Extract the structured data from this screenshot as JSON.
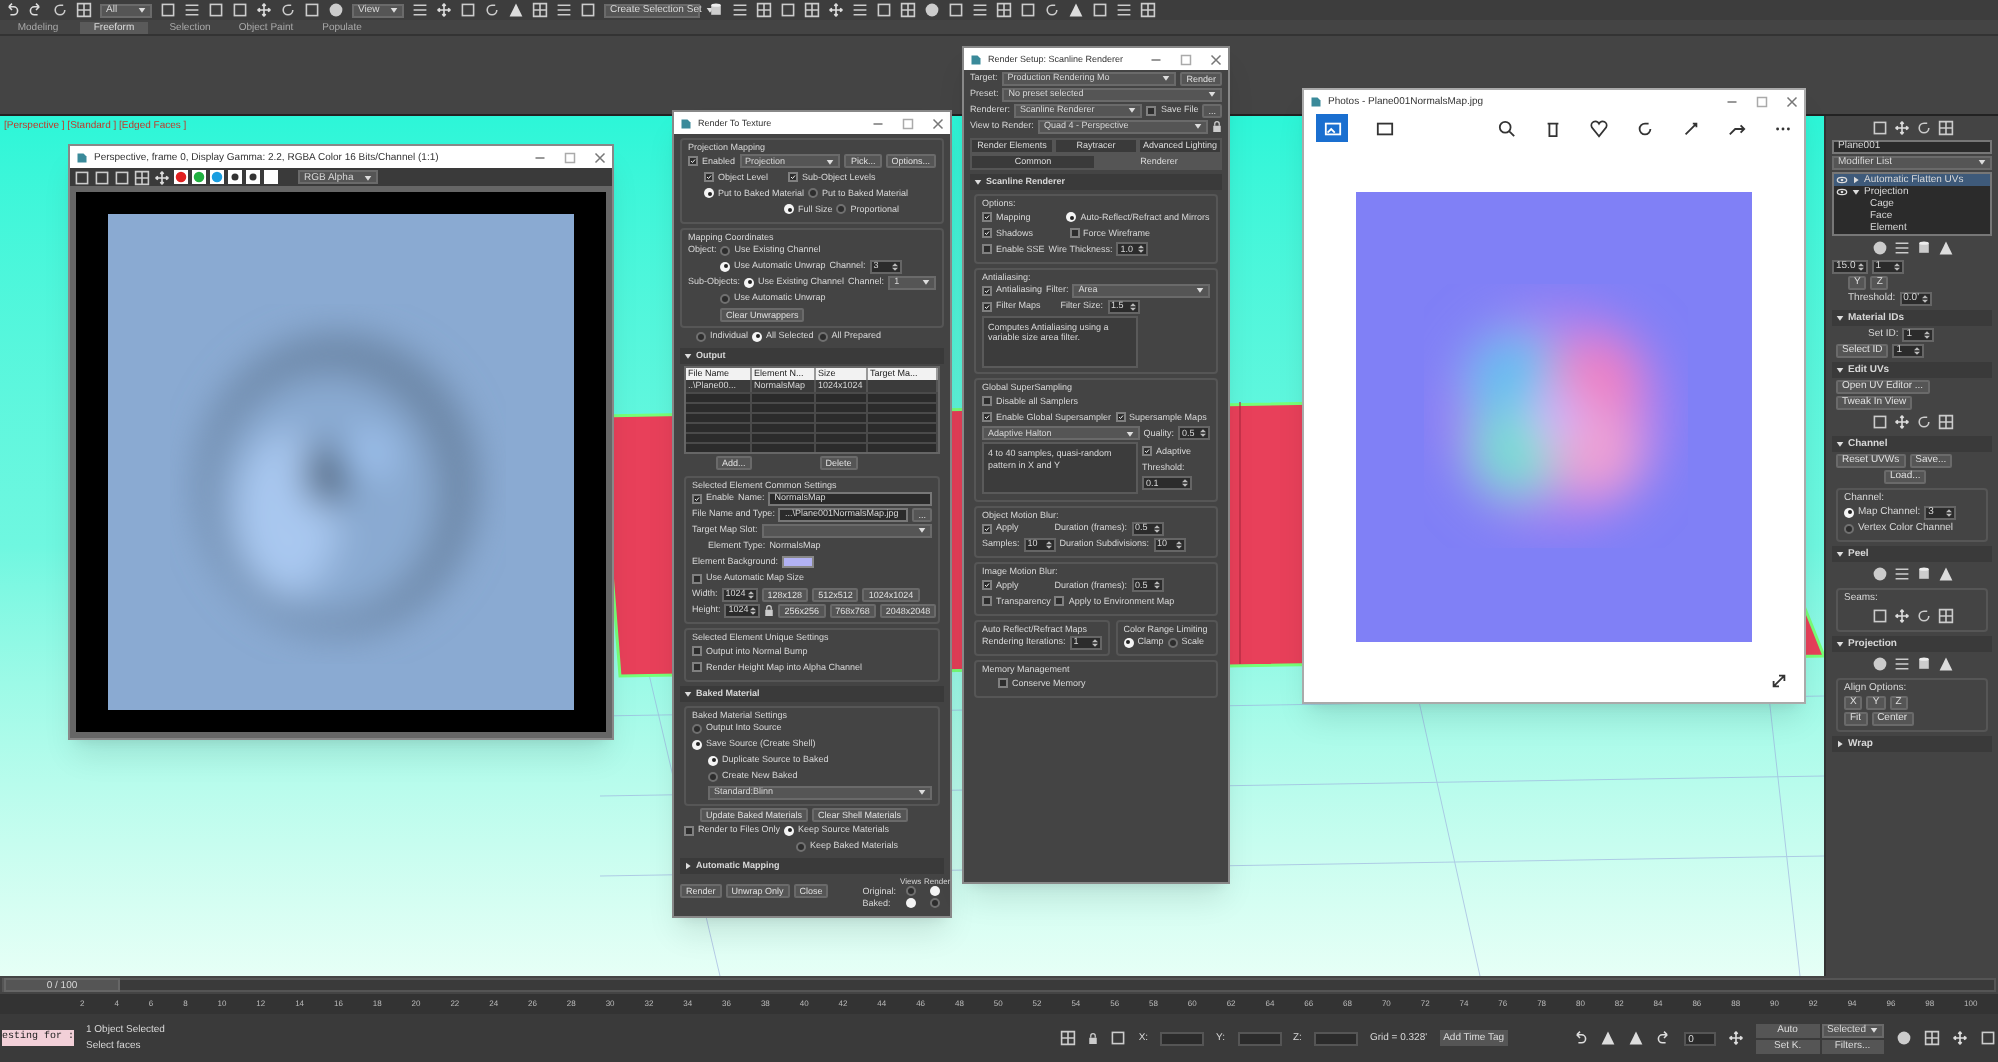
{
  "toolbar": {
    "dropdowns": [
      "All",
      "View",
      "Create Selection Set"
    ]
  },
  "ribbon_tabs": [
    {
      "label": "Modeling",
      "selected": false
    },
    {
      "label": "Freeform",
      "selected": true
    },
    {
      "label": "Selection",
      "selected": false
    },
    {
      "label": "Object Paint",
      "selected": false
    },
    {
      "label": "Populate",
      "selected": false
    }
  ],
  "viewport": {
    "label": "[Perspective ] [Standard ] [Edged Faces ]"
  },
  "frame_buffer": {
    "title": "Perspective, frame 0, Display Gamma: 2.2, RGBA Color 16 Bits/Channel (1:1)",
    "channel": "RGB Alpha"
  },
  "render_to_texture": {
    "title": "Render To Texture",
    "blocks": [
      {
        "kind": "group",
        "title": "Projection Mapping",
        "blocks": [
          {
            "kind": "row",
            "items": [
              {
                "kind": "check",
                "label": "Enabled",
                "checked": true
              },
              {
                "kind": "dropdown",
                "value": "Projection"
              },
              {
                "kind": "button",
                "label": "Pick..."
              },
              {
                "kind": "button",
                "label": "Options..."
              }
            ]
          },
          {
            "kind": "row",
            "items": [
              {
                "kind": "indent"
              },
              {
                "kind": "check",
                "label": "Object Level",
                "checked": true
              },
              {
                "kind": "indent"
              },
              {
                "kind": "check",
                "label": "Sub-Object Levels",
                "checked": true
              }
            ]
          },
          {
            "kind": "row",
            "items": [
              {
                "kind": "indent"
              },
              {
                "kind": "radio",
                "label": "Put to Baked Material",
                "selected": true
              },
              {
                "kind": "radio",
                "label": "Put to Baked Material",
                "selected": false
              }
            ]
          },
          {
            "kind": "row",
            "items": [
              {
                "kind": "indent"
              },
              {
                "kind": "indent"
              },
              {
                "kind": "indent"
              },
              {
                "kind": "indent"
              },
              {
                "kind": "indent"
              },
              {
                "kind": "indent"
              },
              {
                "kind": "radio",
                "label": "Full Size",
                "selected": true
              },
              {
                "kind": "radio",
                "label": "Proportional",
                "selected": false
              }
            ]
          }
        ]
      },
      {
        "kind": "group",
        "title": "Mapping Coordinates",
        "blocks": [
          {
            "kind": "row",
            "items": [
              {
                "kind": "label",
                "text": "Object:"
              },
              {
                "kind": "radio",
                "label": "Use Existing Channel",
                "selected": false
              }
            ]
          },
          {
            "kind": "row",
            "items": [
              {
                "kind": "indent"
              },
              {
                "kind": "indent"
              },
              {
                "kind": "radio",
                "label": "Use Automatic Unwrap",
                "selected": true
              },
              {
                "kind": "label",
                "text": "Channel:"
              },
              {
                "kind": "spinner",
                "value": "3"
              }
            ]
          },
          {
            "kind": "row",
            "items": [
              {
                "kind": "label",
                "text": "Sub-Objects:"
              },
              {
                "kind": "radio",
                "label": "Use Existing Channel",
                "selected": true
              },
              {
                "kind": "label",
                "text": "Channel:"
              },
              {
                "kind": "dropdown",
                "value": "1"
              }
            ]
          },
          {
            "kind": "row",
            "items": [
              {
                "kind": "indent"
              },
              {
                "kind": "indent"
              },
              {
                "kind": "radio",
                "label": "Use Automatic Unwrap",
                "selected": false
              }
            ]
          },
          {
            "kind": "row",
            "items": [
              {
                "kind": "indent"
              },
              {
                "kind": "indent"
              },
              {
                "kind": "button",
                "label": "Clear Unwrappers"
              }
            ]
          }
        ]
      },
      {
        "kind": "row",
        "items": [
          {
            "kind": "indent"
          },
          {
            "kind": "radio",
            "label": "Individual",
            "selected": false
          },
          {
            "kind": "radio",
            "label": "All Selected",
            "selected": true
          },
          {
            "kind": "radio",
            "label": "All Prepared",
            "selected": false
          }
        ]
      },
      {
        "kind": "rollout",
        "title": "Output",
        "expanded": true,
        "blocks": [
          {
            "kind": "table",
            "columns": [
              "File Name",
              "Element N...",
              "Size",
              "Target Ma..."
            ],
            "rows": [
              [
                "..\\Plane00...",
                "NormalsMap",
                "1024x1024",
                ""
              ]
            ]
          },
          {
            "kind": "row",
            "items": [
              {
                "kind": "indent"
              },
              {
                "kind": "indent"
              },
              {
                "kind": "button",
                "label": "Add..."
              },
              {
                "kind": "indent"
              },
              {
                "kind": "indent"
              },
              {
                "kind": "indent"
              },
              {
                "kind": "indent"
              },
              {
                "kind": "button",
                "label": "Delete"
              }
            ]
          },
          {
            "kind": "group",
            "title": "Selected Element Common Settings",
            "blocks": [
              {
                "kind": "row",
                "items": [
                  {
                    "kind": "check",
                    "label": "Enable",
                    "checked": true
                  },
                  {
                    "kind": "label",
                    "text": "Name:"
                  },
                  {
                    "kind": "field",
                    "value": "NormalsMap"
                  }
                ]
              },
              {
                "kind": "row",
                "items": [
                  {
                    "kind": "label",
                    "text": "File Name and Type:"
                  },
                  {
                    "kind": "field",
                    "value": "...\\Plane001NormalsMap.jpg"
                  },
                  {
                    "kind": "button",
                    "label": "..."
                  }
                ]
              },
              {
                "kind": "row",
                "items": [
                  {
                    "kind": "label",
                    "text": "Target Map Slot:"
                  },
                  {
                    "kind": "dropdown",
                    "value": ""
                  }
                ]
              },
              {
                "kind": "row",
                "items": [
                  {
                    "kind": "indent"
                  },
                  {
                    "kind": "label",
                    "text": "Element Type:"
                  },
                  {
                    "kind": "label",
                    "text": "NormalsMap"
                  }
                ]
              },
              {
                "kind": "row",
                "items": [
                  {
                    "kind": "label",
                    "text": "Element Background:"
                  },
                  {
                    "kind": "swatch"
                  }
                ]
              },
              {
                "kind": "row",
                "items": [
                  {
                    "kind": "check",
                    "label": "Use Automatic Map Size",
                    "checked": false
                  }
                ]
              },
              {
                "kind": "row",
                "items": [
                  {
                    "kind": "label",
                    "text": "Width:"
                  },
                  {
                    "kind": "spinner",
                    "value": "1024"
                  },
                  {
                    "kind": "button",
                    "label": "128x128"
                  },
                  {
                    "kind": "button",
                    "label": "512x512"
                  },
                  {
                    "kind": "button",
                    "label": "1024x1024"
                  }
                ]
              },
              {
                "kind": "row",
                "items": [
                  {
                    "kind": "label",
                    "text": "Height:"
                  },
                  {
                    "kind": "spinner",
                    "value": "1024"
                  },
                  {
                    "kind": "lock"
                  },
                  {
                    "kind": "button",
                    "label": "256x256"
                  },
                  {
                    "kind": "button",
                    "label": "768x768"
                  },
                  {
                    "kind": "button",
                    "label": "2048x2048"
                  }
                ]
              }
            ]
          },
          {
            "kind": "group",
            "title": "Selected Element Unique Settings",
            "blocks": [
              {
                "kind": "row",
                "items": [
                  {
                    "kind": "check",
                    "label": "Output into Normal Bump",
                    "checked": false
                  }
                ]
              },
              {
                "kind": "row",
                "items": [
                  {
                    "kind": "check",
                    "label": "Render Height Map into Alpha Channel",
                    "checked": false
                  }
                ]
              }
            ]
          }
        ]
      },
      {
        "kind": "rollout",
        "title": "Baked Material",
        "expanded": true,
        "blocks": [
          {
            "kind": "group",
            "title": "Baked Material Settings",
            "blocks": [
              {
                "kind": "row",
                "items": [
                  {
                    "kind": "radio",
                    "label": "Output Into Source",
                    "selected": false
                  }
                ]
              },
              {
                "kind": "row",
                "items": [
                  {
                    "kind": "radio",
                    "label": "Save Source (Create Shell)",
                    "selected": true
                  }
                ]
              },
              {
                "kind": "row",
                "items": [
                  {
                    "kind": "indent"
                  },
                  {
                    "kind": "radio",
                    "label": "Duplicate Source to Baked",
                    "selected": true
                  }
                ]
              },
              {
                "kind": "row",
                "items": [
                  {
                    "kind": "indent"
                  },
                  {
                    "kind": "radio",
                    "label": "Create New Baked",
                    "selected": false
                  }
                ]
              },
              {
                "kind": "row",
                "items": [
                  {
                    "kind": "indent"
                  },
                  {
                    "kind": "dropdown",
                    "value": "Standard:Blinn"
                  }
                ]
              }
            ]
          },
          {
            "kind": "row",
            "items": [
              {
                "kind": "indent"
              },
              {
                "kind": "button",
                "label": "Update Baked Materials"
              },
              {
                "kind": "button",
                "label": "Clear Shell Materials"
              }
            ]
          },
          {
            "kind": "row",
            "items": [
              {
                "kind": "check",
                "label": "Render to Files Only",
                "checked": false
              },
              {
                "kind": "radio",
                "label": "Keep Source Materials",
                "selected": true
              }
            ]
          },
          {
            "kind": "row",
            "items": [
              {
                "kind": "indent"
              },
              {
                "kind": "indent"
              },
              {
                "kind": "indent"
              },
              {
                "kind": "indent"
              },
              {
                "kind": "indent"
              },
              {
                "kind": "indent"
              },
              {
                "kind": "indent"
              },
              {
                "kind": "radio",
                "label": "Keep Baked Materials",
                "selected": false
              }
            ]
          }
        ]
      },
      {
        "kind": "rollout",
        "title": "Automatic Mapping",
        "expanded": false
      },
      {
        "kind": "row",
        "items": [
          {
            "kind": "button",
            "label": "Render"
          },
          {
            "kind": "button",
            "label": "Unwrap Only"
          },
          {
            "kind": "button",
            "label": "Close"
          },
          {
            "kind": "matrix",
            "columns": [
              "Views",
              "Render"
            ],
            "rows": [
              {
                "label": "Original:",
                "options": [
                  {
                    "selected": false
                  },
                  {
                    "selected": true
                  }
                ]
              },
              {
                "label": "Baked:",
                "options": [
                  {
                    "selected": true
                  },
                  {
                    "selected": false
                  }
                ]
              }
            ]
          }
        ]
      }
    ]
  },
  "render_setup": {
    "title": "Render Setup: Scanline Renderer",
    "blocks": [
      {
        "kind": "row",
        "items": [
          {
            "kind": "label",
            "text": "Target:"
          },
          {
            "kind": "dropdown",
            "value": "Production Rendering Mo"
          },
          {
            "kind": "button",
            "label": "Render"
          }
        ]
      },
      {
        "kind": "row",
        "items": [
          {
            "kind": "label",
            "text": "Preset:"
          },
          {
            "kind": "dropdown",
            "value": "No preset selected"
          }
        ]
      },
      {
        "kind": "row",
        "items": [
          {
            "kind": "label",
            "text": "Renderer:"
          },
          {
            "kind": "dropdown",
            "value": "Scanline Renderer"
          },
          {
            "kind": "check",
            "label": "Save File",
            "checked": false
          },
          {
            "kind": "button",
            "label": "..."
          }
        ]
      },
      {
        "kind": "row",
        "items": [
          {
            "kind": "label",
            "text": "View to Render:"
          },
          {
            "kind": "dropdown",
            "value": "Quad 4 - Perspective"
          },
          {
            "kind": "lock"
          }
        ]
      },
      {
        "kind": "tabs",
        "tabs": [
          {
            "label": "Render Elements",
            "selected": false
          },
          {
            "label": "Raytracer",
            "selected": false
          },
          {
            "label": "Advanced Lighting",
            "selected": false
          },
          {
            "label": "Common",
            "selected": false
          },
          {
            "label": "Renderer",
            "selected": true
          }
        ]
      },
      {
        "kind": "rollout",
        "title": "Scanline Renderer",
        "expanded": true,
        "blocks": [
          {
            "kind": "group",
            "title": "Options:",
            "blocks": [
              {
                "kind": "row",
                "items": [
                  {
                    "kind": "check",
                    "label": "Mapping",
                    "checked": true
                  },
                  {
                    "kind": "indent"
                  },
                  {
                    "kind": "indent"
                  },
                  {
                    "kind": "radio",
                    "label": "Auto-Reflect/Refract and Mirrors",
                    "selected": true
                  }
                ]
              },
              {
                "kind": "row",
                "items": [
                  {
                    "kind": "check",
                    "label": "Shadows",
                    "checked": true
                  },
                  {
                    "kind": "indent"
                  },
                  {
                    "kind": "indent"
                  },
                  {
                    "kind": "check",
                    "label": "Force Wireframe",
                    "checked": false
                  }
                ]
              },
              {
                "kind": "row",
                "items": [
                  {
                    "kind": "check",
                    "label": "Enable SSE",
                    "checked": false
                  },
                  {
                    "kind": "label",
                    "text": "Wire Thickness:"
                  },
                  {
                    "kind": "spinner",
                    "value": "1.0"
                  }
                ]
              }
            ]
          },
          {
            "kind": "group",
            "title": "Antialiasing:",
            "blocks": [
              {
                "kind": "row",
                "items": [
                  {
                    "kind": "check",
                    "label": "Antialiasing",
                    "checked": true
                  },
                  {
                    "kind": "label",
                    "text": "Filter:"
                  },
                  {
                    "kind": "dropdown",
                    "value": "Area"
                  }
                ]
              },
              {
                "kind": "row",
                "items": [
                  {
                    "kind": "check",
                    "label": "Filter Maps",
                    "checked": true
                  },
                  {
                    "kind": "indent"
                  },
                  {
                    "kind": "label",
                    "text": "Filter Size:"
                  },
                  {
                    "kind": "spinner",
                    "value": "1.5"
                  }
                ]
              },
              {
                "kind": "row",
                "items": [
                  {
                    "kind": "note",
                    "text": "Computes Antialiasing using a variable size area filter."
                  }
                ]
              }
            ]
          },
          {
            "kind": "group",
            "title": "Global SuperSampling",
            "blocks": [
              {
                "kind": "row",
                "items": [
                  {
                    "kind": "check",
                    "label": "Disable all Samplers",
                    "checked": false
                  }
                ]
              },
              {
                "kind": "row",
                "items": [
                  {
                    "kind": "check",
                    "label": "Enable Global Supersampler",
                    "checked": true
                  },
                  {
                    "kind": "check",
                    "label": "Supersample Maps",
                    "checked": true
                  }
                ]
              },
              {
                "kind": "row",
                "items": [
                  {
                    "kind": "dropdown",
                    "value": "Adaptive Halton"
                  },
                  {
                    "kind": "label",
                    "text": "Quality:"
                  },
                  {
                    "kind": "spinner",
                    "value": "0.5"
                  }
                ]
              },
              {
                "kind": "row",
                "items": [
                  {
                    "kind": "note",
                    "text": "4 to 40 samples, quasi-random pattern in X and Y"
                  },
                  {
                    "kind": "stack",
                    "items": [
                      {
                        "kind": "check",
                        "label": "Adaptive",
                        "checked": true
                      },
                      {
                        "kind": "label",
                        "text": "Threshold:"
                      },
                      {
                        "kind": "spinner",
                        "value": "0.1"
                      }
                    ]
                  }
                ]
              }
            ]
          },
          {
            "kind": "group",
            "title": "Object Motion Blur:",
            "blocks": [
              {
                "kind": "row",
                "items": [
                  {
                    "kind": "check",
                    "label": "Apply",
                    "checked": true
                  },
                  {
                    "kind": "indent"
                  },
                  {
                    "kind": "indent"
                  },
                  {
                    "kind": "label",
                    "text": "Duration (frames):"
                  },
                  {
                    "kind": "spinner",
                    "value": "0.5"
                  }
                ]
              },
              {
                "kind": "row",
                "items": [
                  {
                    "kind": "label",
                    "text": "Samples:"
                  },
                  {
                    "kind": "spinner",
                    "value": "10"
                  },
                  {
                    "kind": "label",
                    "text": "Duration Subdivisions:"
                  },
                  {
                    "kind": "spinner",
                    "value": "10"
                  }
                ]
              }
            ]
          },
          {
            "kind": "group",
            "title": "Image Motion Blur:",
            "blocks": [
              {
                "kind": "row",
                "items": [
                  {
                    "kind": "check",
                    "label": "Apply",
                    "checked": true
                  },
                  {
                    "kind": "indent"
                  },
                  {
                    "kind": "indent"
                  },
                  {
                    "kind": "label",
                    "text": "Duration (frames):"
                  },
                  {
                    "kind": "spinner",
                    "value": "0.5"
                  }
                ]
              },
              {
                "kind": "row",
                "items": [
                  {
                    "kind": "check",
                    "label": "Transparency",
                    "checked": false
                  },
                  {
                    "kind": "check",
                    "label": "Apply to Environment Map",
                    "checked": false
                  }
                ]
              }
            ]
          },
          {
            "kind": "split",
            "groups": [
              {
                "kind": "group",
                "title": "Auto Reflect/Refract Maps",
                "blocks": [
                  {
                    "kind": "row",
                    "items": [
                      {
                        "kind": "label",
                        "text": "Rendering Iterations:"
                      },
                      {
                        "kind": "spinner",
                        "value": "1"
                      }
                    ]
                  }
                ]
              },
              {
                "kind": "group",
                "title": "Color Range Limiting",
                "blocks": [
                  {
                    "kind": "row",
                    "items": [
                      {
                        "kind": "radio",
                        "label": "Clamp",
                        "selected": true
                      },
                      {
                        "kind": "radio",
                        "label": "Scale",
                        "selected": false
                      }
                    ]
                  }
                ]
              }
            ]
          },
          {
            "kind": "group",
            "title": "Memory Management",
            "blocks": [
              {
                "kind": "row",
                "items": [
                  {
                    "kind": "indent"
                  },
                  {
                    "kind": "check",
                    "label": "Conserve Memory",
                    "checked": false
                  }
                ]
              }
            ]
          }
        ]
      }
    ]
  },
  "photos": {
    "title": "Photos - Plane001NormalsMap.jpg"
  },
  "command_panel": {
    "blocks": [
      {
        "kind": "iconrow"
      },
      {
        "kind": "row",
        "items": [
          {
            "kind": "field",
            "value": "Plane001"
          }
        ]
      },
      {
        "kind": "row",
        "items": [
          {
            "kind": "dropdown",
            "value": "Modifier List"
          }
        ]
      },
      {
        "kind": "tree",
        "items": [
          {
            "label": "Automatic Flatten UVs",
            "selected": true,
            "expanded": false
          },
          {
            "label": "Projection",
            "selected": false,
            "expanded": true,
            "children": [
              {
                "label": "Cage",
                "selected": false
              },
              {
                "label": "Face",
                "selected": false
              },
              {
                "label": "Element",
                "selected": false
              }
            ]
          }
        ]
      },
      {
        "kind": "iconrow"
      },
      {
        "kind": "row",
        "items": [
          {
            "kind": "spinner",
            "value": "15.0"
          },
          {
            "kind": "spinner",
            "value": "1"
          }
        ]
      },
      {
        "kind": "row",
        "items": [
          {
            "kind": "indent"
          },
          {
            "kind": "button",
            "label": "Y"
          },
          {
            "kind": "button",
            "label": "Z"
          }
        ]
      },
      {
        "kind": "row",
        "items": [
          {
            "kind": "indent"
          },
          {
            "kind": "label",
            "text": "Threshold:"
          },
          {
            "kind": "spinner",
            "value": "0.0'"
          }
        ]
      },
      {
        "kind": "rollout",
        "title": "Material IDs",
        "expanded": true,
        "blocks": [
          {
            "kind": "row",
            "items": [
              {
                "kind": "indent"
              },
              {
                "kind": "indent"
              },
              {
                "kind": "label",
                "text": "Set ID:"
              },
              {
                "kind": "spinner",
                "value": "1"
              }
            ]
          },
          {
            "kind": "row",
            "items": [
              {
                "kind": "button",
                "label": "Select ID"
              },
              {
                "kind": "spinner",
                "value": "1"
              }
            ]
          }
        ]
      },
      {
        "kind": "rollout",
        "title": "Edit UVs",
        "expanded": true,
        "blocks": [
          {
            "kind": "row",
            "items": [
              {
                "kind": "button",
                "label": "Open UV Editor ..."
              }
            ]
          },
          {
            "kind": "row",
            "items": [
              {
                "kind": "button",
                "label": "Tweak In View"
              }
            ]
          },
          {
            "kind": "iconrow"
          }
        ]
      },
      {
        "kind": "rollout",
        "title": "Channel",
        "expanded": true,
        "blocks": [
          {
            "kind": "row",
            "items": [
              {
                "kind": "button",
                "label": "Reset UVWs"
              },
              {
                "kind": "button",
                "label": "Save..."
              }
            ]
          },
          {
            "kind": "row",
            "items": [
              {
                "kind": "indent"
              },
              {
                "kind": "indent"
              },
              {
                "kind": "indent"
              },
              {
                "kind": "button",
                "label": "Load..."
              }
            ]
          },
          {
            "kind": "group",
            "title": "Channel:",
            "blocks": [
              {
                "kind": "row",
                "items": [
                  {
                    "kind": "radio",
                    "label": "Map Channel:",
                    "selected": true
                  },
                  {
                    "kind": "spinner",
                    "value": "3"
                  }
                ]
              },
              {
                "kind": "row",
                "items": [
                  {
                    "kind": "radio",
                    "label": "Vertex Color Channel",
                    "selected": false
                  }
                ]
              }
            ]
          }
        ]
      },
      {
        "kind": "rollout",
        "title": "Peel",
        "expanded": true,
        "blocks": [
          {
            "kind": "iconrow"
          },
          {
            "kind": "group",
            "title": "Seams:",
            "blocks": [
              {
                "kind": "iconrow"
              }
            ]
          }
        ]
      },
      {
        "kind": "rollout",
        "title": "Projection",
        "expanded": true,
        "blocks": [
          {
            "kind": "iconrow"
          },
          {
            "kind": "group",
            "title": "Align Options:",
            "blocks": [
              {
                "kind": "row",
                "items": [
                  {
                    "kind": "button",
                    "label": "X"
                  },
                  {
                    "kind": "button",
                    "label": "Y"
                  },
                  {
                    "kind": "button",
                    "label": "Z"
                  }
                ]
              },
              {
                "kind": "row",
                "items": [
                  {
                    "kind": "button",
                    "label": "Fit"
                  },
                  {
                    "kind": "button",
                    "label": "Center"
                  }
                ]
              }
            ]
          }
        ]
      },
      {
        "kind": "rollout",
        "title": "Wrap",
        "expanded": false
      }
    ]
  },
  "timeline": {
    "position": "0 / 100",
    "ticks": [
      "2",
      "4",
      "6",
      "8",
      "10",
      "12",
      "14",
      "16",
      "18",
      "20",
      "22",
      "24",
      "26",
      "28",
      "30",
      "32",
      "34",
      "36",
      "38",
      "40",
      "42",
      "44",
      "46",
      "48",
      "50",
      "52",
      "54",
      "56",
      "58",
      "60",
      "62",
      "64",
      "66",
      "68",
      "70",
      "72",
      "74",
      "76",
      "78",
      "80",
      "82",
      "84",
      "86",
      "88",
      "90",
      "92",
      "94",
      "96",
      "98",
      "100"
    ]
  },
  "status_bar": {
    "listener": "esting for :",
    "selection": "1 Object Selected",
    "prompt": "Select faces",
    "coords": [
      "X:",
      "Y:",
      "Z:"
    ],
    "grid": "Grid = 0.328'",
    "time_tag": "Add Time Tag",
    "auto": "Auto",
    "key_filter": "Selected",
    "set_key": "Set K.",
    "filters": "Filters...",
    "frame": "0"
  }
}
